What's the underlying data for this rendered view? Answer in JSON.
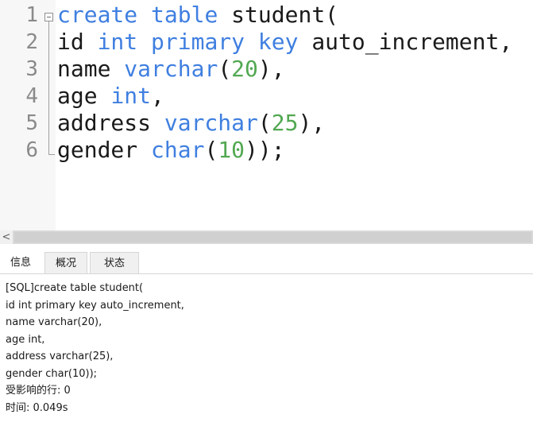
{
  "editor": {
    "lines": [
      {
        "number": "1",
        "tokens": [
          {
            "t": "create",
            "c": "kw"
          },
          {
            "t": " ",
            "c": "plain"
          },
          {
            "t": "table",
            "c": "kw"
          },
          {
            "t": " student(",
            "c": "plain"
          }
        ]
      },
      {
        "number": "2",
        "tokens": [
          {
            "t": "id ",
            "c": "plain"
          },
          {
            "t": "int",
            "c": "kw"
          },
          {
            "t": " ",
            "c": "plain"
          },
          {
            "t": "primary",
            "c": "kw"
          },
          {
            "t": " ",
            "c": "plain"
          },
          {
            "t": "key",
            "c": "kw"
          },
          {
            "t": " auto_increment,",
            "c": "plain"
          }
        ]
      },
      {
        "number": "3",
        "tokens": [
          {
            "t": "name ",
            "c": "plain"
          },
          {
            "t": "varchar",
            "c": "kw"
          },
          {
            "t": "(",
            "c": "plain"
          },
          {
            "t": "20",
            "c": "num"
          },
          {
            "t": "),",
            "c": "plain"
          }
        ]
      },
      {
        "number": "4",
        "tokens": [
          {
            "t": "age ",
            "c": "plain"
          },
          {
            "t": "int",
            "c": "kw"
          },
          {
            "t": ",",
            "c": "plain"
          }
        ]
      },
      {
        "number": "5",
        "tokens": [
          {
            "t": "address ",
            "c": "plain"
          },
          {
            "t": "varchar",
            "c": "kw"
          },
          {
            "t": "(",
            "c": "plain"
          },
          {
            "t": "25",
            "c": "num"
          },
          {
            "t": "),",
            "c": "plain"
          }
        ]
      },
      {
        "number": "6",
        "tokens": [
          {
            "t": "gender ",
            "c": "plain"
          },
          {
            "t": "char",
            "c": "kw"
          },
          {
            "t": "(",
            "c": "plain"
          },
          {
            "t": "10",
            "c": "num"
          },
          {
            "t": "));",
            "c": "plain"
          }
        ]
      }
    ],
    "colors": {
      "keyword": "#3f7fe0",
      "number": "#52a852",
      "text": "#1a1a1a",
      "line_number": "#8a8a8a"
    }
  },
  "scrollbar": {
    "left_arrow": "<"
  },
  "tabs": [
    {
      "label": "信息",
      "active": true
    },
    {
      "label": "概况",
      "active": false
    },
    {
      "label": "状态",
      "active": false
    }
  ],
  "output": {
    "lines": [
      "[SQL]create table student(",
      "id int primary key auto_increment,",
      "name varchar(20),",
      "age int,",
      "address varchar(25),",
      "gender char(10));",
      "受影响的行: 0",
      "时间: 0.049s"
    ]
  }
}
